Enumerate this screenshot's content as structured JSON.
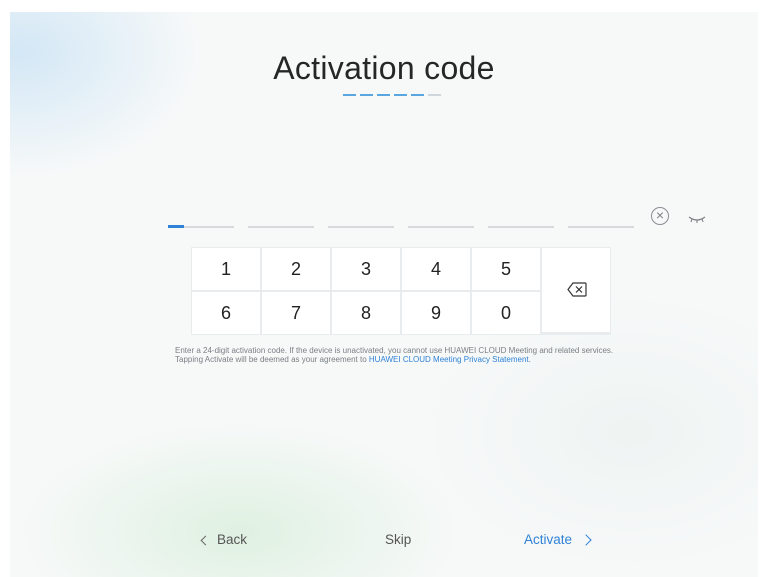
{
  "title": "Activation code",
  "progress": {
    "total_steps": 6,
    "completed_steps": 5
  },
  "code_input": {
    "groups": 6,
    "digits_per_group": 4,
    "total_digits": 24,
    "value": ""
  },
  "icons": {
    "clear": "clear-circle-icon",
    "visibility": "eye-closed-icon",
    "delete": "backspace-icon"
  },
  "keypad": {
    "row1": [
      "1",
      "2",
      "3",
      "4",
      "5"
    ],
    "row2": [
      "6",
      "7",
      "8",
      "9",
      "0"
    ]
  },
  "notice": {
    "text": "Enter a 24-digit activation code. If the device is unactivated, you cannot use HUAWEI CLOUD Meeting and related services. Tapping Activate will be deemed as your agreement to ",
    "link": "HUAWEI CLOUD Meeting Privacy Statement",
    "end": "."
  },
  "nav": {
    "back": "Back",
    "skip": "Skip",
    "activate": "Activate"
  },
  "colors": {
    "accent": "#2f82d6",
    "text": "#262626",
    "muted": "#7a7f83"
  }
}
